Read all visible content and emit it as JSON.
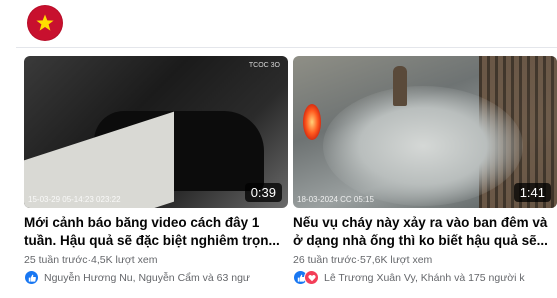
{
  "page": {
    "avatar_icon": "star-flag-icon",
    "brand_color": "#c8102e"
  },
  "videos": [
    {
      "duration": "0:39",
      "title": "Mới cảnh báo băng video cách đây 1 tuần. Hậu quả sẽ đặc biệt nghiêm trọn...",
      "meta": "25 tuần trước·4,5K lượt xem",
      "reactions_icons": [
        "like-icon"
      ],
      "reactions_text": "Nguyễn Hương Nu, Nguyễn Cẩm và 63 ngư",
      "cam_tag": "TCOC 3O",
      "cam_stamp": "15-03-29 05-14:23 023:22"
    },
    {
      "duration": "1:41",
      "title": "Nếu vụ cháy này xảy ra vào ban đêm và ở dạng nhà ống thì ko biết hậu quả sẽ...",
      "meta": "26 tuần trước·57,6K lượt xem",
      "reactions_icons": [
        "like-icon",
        "love-icon"
      ],
      "reactions_text": "Lê Trương Xuân Vy, Khánh và 175 người k",
      "cam_stamp": "18-03-2024 CC 05:15"
    }
  ]
}
